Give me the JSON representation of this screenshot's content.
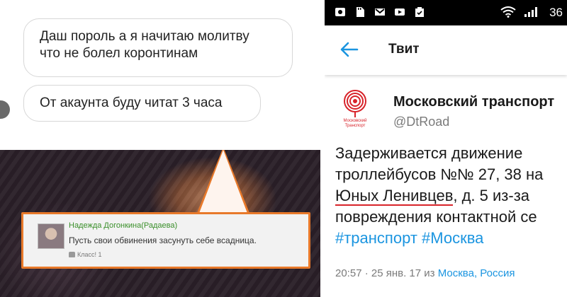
{
  "chat": {
    "message_1_line_1": "Даш пороль а я начитаю молитву",
    "message_1_line_2": "что не болел коронтинам",
    "message_2": "От акаунта буду читат 3 часа"
  },
  "comment": {
    "author": "Надежда Догонкина(Радаева)",
    "text": "Пусть свои обвинения засунуть себе всадница.",
    "like_label": "Класс! 1"
  },
  "status_bar": {
    "time": "36",
    "icons": [
      "notification-icon",
      "sd-card-icon",
      "gmail-icon",
      "youtube-icon",
      "clipboard-icon",
      "wifi-icon",
      "signal-icon"
    ]
  },
  "twitter": {
    "header_title": "Твит",
    "account_name": "Московский транспорт",
    "account_handle": "@DtRoad",
    "logo_caption_1": "Московский",
    "logo_caption_2": "Транспорт",
    "tweet_line_1": "Задерживается движение",
    "tweet_line_2": "троллейбусов №№ 27, 38 на",
    "tweet_line_3a": "Юных Ленивцев",
    "tweet_line_3b": ", д. 5 из-за",
    "tweet_line_4": "повреждения контактной се",
    "hashtag_1": "#транспорт",
    "hashtag_2": "#Москва",
    "meta_time": "20:57 · 25 янв. 17 из",
    "meta_place_1": "Москва",
    "meta_place_sep": ", ",
    "meta_place_2": "Россия"
  },
  "colors": {
    "comment_border": "#e8792a",
    "comment_author": "#3a8f2a",
    "twitter_blue": "#1b95e0",
    "logo_red": "#d8232a"
  }
}
